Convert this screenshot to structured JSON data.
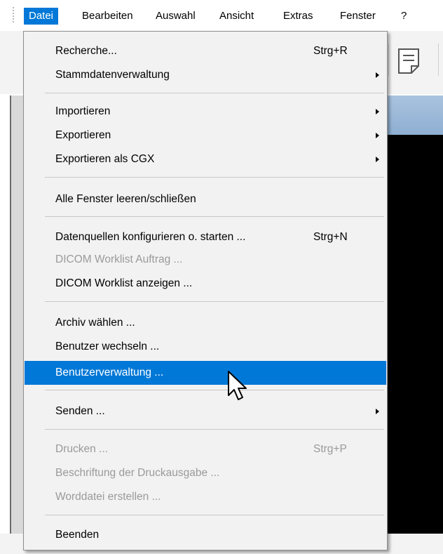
{
  "menubar": {
    "items": [
      {
        "label": "Datei",
        "active": true
      },
      {
        "label": "Bearbeiten"
      },
      {
        "label": "Auswahl"
      },
      {
        "label": "Ansicht"
      },
      {
        "label": "Extras"
      },
      {
        "label": "Fenster"
      },
      {
        "label": "?"
      }
    ]
  },
  "menu": {
    "items": [
      {
        "label": "Recherche...",
        "shortcut": "Strg+R"
      },
      {
        "label": "Stammdatenverwaltung",
        "submenu": true
      },
      {
        "label": "Importieren",
        "submenu": true
      },
      {
        "label": "Exportieren",
        "submenu": true
      },
      {
        "label": "Exportieren als CGX",
        "submenu": true
      },
      {
        "label": "Alle Fenster leeren/schließen"
      },
      {
        "label": "Datenquellen konfigurieren o. starten ...",
        "shortcut": "Strg+N"
      },
      {
        "label": "DICOM Worklist Auftrag ...",
        "disabled": true
      },
      {
        "label": "DICOM Worklist anzeigen ..."
      },
      {
        "label": "Archiv wählen ..."
      },
      {
        "label": "Benutzer wechseln ..."
      },
      {
        "label": "Benutzerverwaltung ...",
        "highlighted": true
      },
      {
        "label": "Senden ...",
        "submenu": true
      },
      {
        "label": "Drucken ...",
        "shortcut": "Strg+P",
        "disabled": true
      },
      {
        "label": "Beschriftung der Druckausgabe ...",
        "disabled": true
      },
      {
        "label": "Worddatei erstellen ...",
        "disabled": true
      },
      {
        "label": "Beenden"
      }
    ]
  },
  "icons": {
    "toolbar_icon": "document-note-icon",
    "cursor": "mouse-pointer-icon",
    "submenu_arrow": "chevron-right-icon"
  },
  "colors": {
    "highlight": "#0078d7",
    "disabled_text": "#9a9a9a",
    "menu_background": "#f2f2f2"
  }
}
